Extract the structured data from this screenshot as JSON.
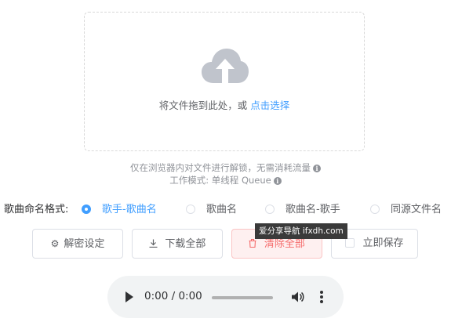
{
  "upload": {
    "prompt": "将文件拖到此处，或 ",
    "link": "点击选择"
  },
  "tips": {
    "line1": "仅在浏览器内对文件进行解锁，无需消耗流量",
    "line2": "工作模式: 单线程 Queue"
  },
  "format": {
    "label": "歌曲命名格式:",
    "options": [
      {
        "label": "歌手-歌曲名",
        "checked": true
      },
      {
        "label": "歌曲名",
        "checked": false
      },
      {
        "label": "歌曲名-歌手",
        "checked": false
      },
      {
        "label": "同源文件名",
        "checked": false
      }
    ]
  },
  "buttons": {
    "settings": "解密设定",
    "download_all": "下载全部",
    "clear_all": "清除全部",
    "save_now": "立即保存"
  },
  "overlay": {
    "watermark": "爱分享导航 ifxdh.com"
  },
  "player": {
    "time": "0:00 / 0:00",
    "progress": 0
  },
  "colors": {
    "accent": "#409eff",
    "danger": "#f56c6c",
    "muted": "#909399"
  },
  "icons": [
    "upload-cloud-icon",
    "info-icon",
    "gear-icon",
    "download-icon",
    "trash-icon",
    "play-icon",
    "volume-icon",
    "more-vert-icon"
  ]
}
